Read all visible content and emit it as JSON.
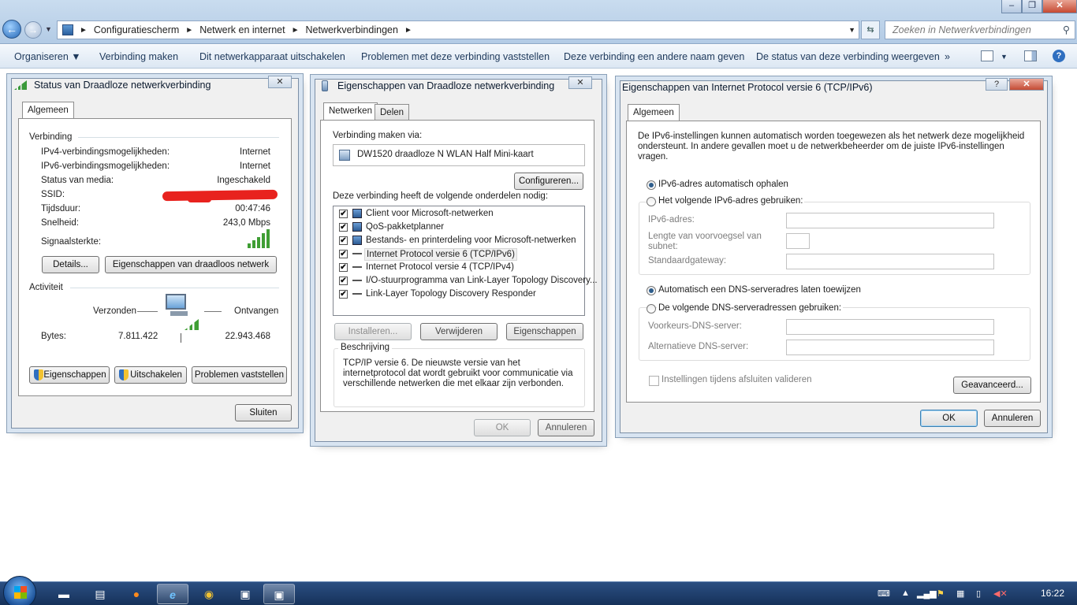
{
  "explorer": {
    "breadcrumb": [
      "Configuratiescherm",
      "Netwerk en internet",
      "Netwerkverbindingen"
    ],
    "search_placeholder": "Zoeken in Netwerkverbindingen",
    "commands": [
      "Organiseren ▼",
      "Verbinding maken",
      "Dit netwerkapparaat uitschakelen",
      "Problemen met deze verbinding vaststellen",
      "Deze verbinding een andere naam geven",
      "De status van deze verbinding weergeven",
      "»"
    ]
  },
  "status_dialog": {
    "title": "Status van Draadloze netwerkverbinding",
    "tab": "Algemeen",
    "section_connection": "Verbinding",
    "rows": [
      {
        "label": "IPv4-verbindingsmogelijkheden:",
        "value": "Internet"
      },
      {
        "label": "IPv6-verbindingsmogelijkheden:",
        "value": "Internet"
      },
      {
        "label": "Status van media:",
        "value": "Ingeschakeld"
      },
      {
        "label": "SSID:",
        "value": ""
      },
      {
        "label": "Tijdsduur:",
        "value": "00:47:46"
      },
      {
        "label": "Snelheid:",
        "value": "243,0 Mbps"
      }
    ],
    "signal_label": "Signaalsterkte:",
    "btn_details": "Details...",
    "btn_wireless_props": "Eigenschappen van draadloos netwerk",
    "section_activity": "Activiteit",
    "sent_label": "Verzonden",
    "received_label": "Ontvangen",
    "bytes_label": "Bytes:",
    "bytes_sent": "7.811.422",
    "bytes_received": "22.943.468",
    "btn_properties": "Eigenschappen",
    "btn_disable": "Uitschakelen",
    "btn_diagnose": "Problemen vaststellen",
    "btn_close": "Sluiten"
  },
  "props_dialog": {
    "title": "Eigenschappen van Draadloze netwerkverbinding",
    "tab_network": "Netwerken",
    "tab_sharing": "Delen",
    "connect_via_label": "Verbinding maken via:",
    "adapter": "DW1520 draadloze N WLAN Half Mini-kaart",
    "btn_configure": "Configureren...",
    "components_label": "Deze verbinding heeft de volgende onderdelen nodig:",
    "components": [
      {
        "label": "Client voor Microsoft-netwerken",
        "checked": true
      },
      {
        "label": "QoS-pakketplanner",
        "checked": true
      },
      {
        "label": "Bestands- en printerdeling voor Microsoft-netwerken",
        "checked": true
      },
      {
        "label": "Internet Protocol versie 6 (TCP/IPv6)",
        "checked": true
      },
      {
        "label": "Internet Protocol versie 4 (TCP/IPv4)",
        "checked": true
      },
      {
        "label": "I/O-stuurprogramma van Link-Layer Topology Discovery...",
        "checked": true
      },
      {
        "label": "Link-Layer Topology Discovery Responder",
        "checked": true
      }
    ],
    "btn_install": "Installeren...",
    "btn_remove": "Verwijderen",
    "btn_props": "Eigenschappen",
    "description_label": "Beschrijving",
    "description": "TCP/IP versie 6. De nieuwste versie van het internetprotocol dat wordt gebruikt voor communicatie via verschillende netwerken die met elkaar zijn verbonden.",
    "btn_ok": "OK",
    "btn_cancel": "Annuleren"
  },
  "ipv6_dialog": {
    "title": "Eigenschappen van Internet Protocol versie 6 (TCP/IPv6)",
    "help": "?",
    "tab": "Algemeen",
    "intro": "De IPv6-instellingen kunnen automatisch worden toegewezen als het netwerk deze mogelijkheid ondersteunt. In andere gevallen moet u de netwerkbeheerder om de juiste IPv6-instellingen vragen.",
    "radio_auto_ip": "IPv6-adres automatisch ophalen",
    "radio_manual_ip": "Het volgende IPv6-adres gebruiken:",
    "ip_label": "IPv6-adres:",
    "prefix_label": "Lengte van voorvoegsel van subnet:",
    "gateway_label": "Standaardgateway:",
    "radio_auto_dns": "Automatisch een DNS-serveradres laten toewijzen",
    "radio_manual_dns": "De volgende DNS-serveradressen gebruiken:",
    "dns1_label": "Voorkeurs-DNS-server:",
    "dns2_label": "Alternatieve DNS-server:",
    "validate_label": "Instellingen tijdens afsluiten valideren",
    "btn_advanced": "Geavanceerd...",
    "btn_ok": "OK",
    "btn_cancel": "Annuleren"
  },
  "taskbar": {
    "clock": "16:22"
  }
}
